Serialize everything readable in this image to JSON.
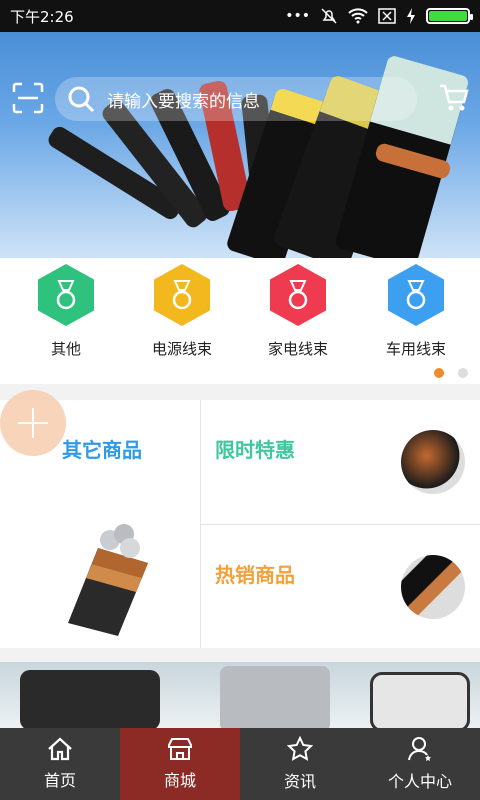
{
  "status": {
    "time": "下午2:26"
  },
  "search": {
    "placeholder": "请输入要搜索的信息"
  },
  "categories": [
    {
      "label": "其他",
      "color": "#2ec27e"
    },
    {
      "label": "电源线束",
      "color": "#f4b81f"
    },
    {
      "label": "家电线束",
      "color": "#ef3b4f"
    },
    {
      "label": "车用线束",
      "color": "#3d9ff0"
    }
  ],
  "promo": {
    "other_title": "其它商品",
    "limited_title": "限时特惠",
    "hot_title": "热销商品",
    "colors": {
      "other": "#2f9be6",
      "limited": "#3ec7a0",
      "hot": "#f3a13a"
    }
  },
  "tabs": [
    {
      "label": "首页",
      "icon": "home-icon",
      "active": false
    },
    {
      "label": "商城",
      "icon": "store-icon",
      "active": true
    },
    {
      "label": "资讯",
      "icon": "star-icon",
      "active": false
    },
    {
      "label": "个人中心",
      "icon": "user-icon",
      "active": false
    }
  ]
}
